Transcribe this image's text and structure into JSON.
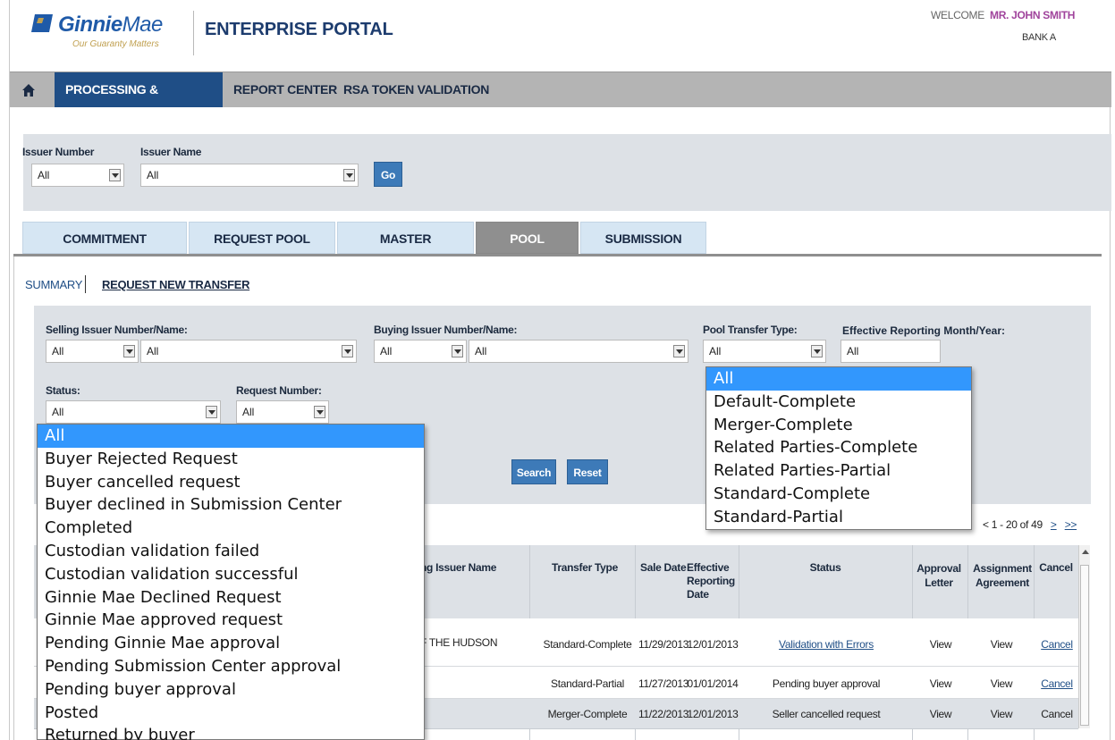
{
  "header": {
    "logo_name_bold": "Ginnie",
    "logo_name_light": "Mae",
    "logo_tagline": "Our Guaranty Matters",
    "portal_title": "ENTERPRISE PORTAL",
    "welcome_label": "WELCOME",
    "user_name": "MR. JOHN SMITH",
    "bank": "BANK A"
  },
  "nav": {
    "home_icon": "home-icon",
    "items": [
      "PROCESSING & SERVICING",
      "REPORT CENTER",
      "RSA TOKEN VALIDATION"
    ],
    "active": "PROCESSING & SERVICING"
  },
  "issuer_filter": {
    "issuer_number_label": "Issuer Number",
    "issuer_number_value": "All",
    "issuer_name_label": "Issuer Name",
    "issuer_name_value": "All",
    "go_label": "Go"
  },
  "tabs": {
    "items": [
      "COMMITMENT MANAGEMENT",
      "REQUEST POOL NUMBERS",
      "MASTER AGREEMENTS",
      "POOL TRANSFER",
      "SUBMISSION CENTER"
    ],
    "active": "POOL TRANSFER"
  },
  "subnav": {
    "summary": "SUMMARY",
    "request_new": "REQUEST NEW TRANSFER"
  },
  "filters": {
    "selling_label": "Selling Issuer Number/Name:",
    "selling_number": "All",
    "selling_name": "All",
    "buying_label": "Buying Issuer Number/Name:",
    "buying_number": "All",
    "buying_name": "All",
    "pool_type_label": "Pool Transfer Type:",
    "pool_type_value": "All",
    "eff_month_label": "Effective Reporting Month/Year:",
    "eff_month_value": "All",
    "status_label": "Status:",
    "status_value": "All",
    "request_number_label": "Request Number:",
    "request_number_value": "All",
    "search_label": "Search",
    "reset_label": "Reset"
  },
  "pool_type_options": [
    "All",
    "Default-Complete",
    "Merger-Complete",
    "Related Parties-Complete",
    "Related Parties-Partial",
    "Standard-Complete",
    "Standard-Partial"
  ],
  "status_options": [
    "All",
    "Buyer Rejected Request",
    "Buyer cancelled request",
    "Buyer declined in Submission Center",
    "Completed",
    "Custodian validation failed",
    "Custodian validation successful",
    "Ginnie Mae Declined Request",
    "Ginnie Mae approved request",
    "Pending Ginnie Mae approval",
    "Pending Submission Center approval",
    "Pending buyer approval",
    "Posted",
    "Returned by buyer"
  ],
  "pager": {
    "prev": "<",
    "range": "1 - 20 of 49",
    "next": ">",
    "last": ">>"
  },
  "table": {
    "headers": {
      "buying_name": "ng Issuer Name",
      "transfer_type": "Transfer Type",
      "sale_date": "Sale Date",
      "eff_date": "Effective Reporting Date",
      "status": "Status",
      "approval": "Approval Letter",
      "assignment": "Assignment Agreement",
      "cancel": "Cancel"
    },
    "rows": [
      {
        "buying_name": "F THE HUDSON",
        "transfer_type": "Standard-Complete",
        "sale_date": "11/29/2013",
        "eff_date": "12/01/2013",
        "status": "Validation with Errors",
        "approval": "View",
        "assignment": "View",
        "cancel": "Cancel"
      },
      {
        "buying_name": "",
        "transfer_type": "Standard-Partial",
        "sale_date": "11/27/2013",
        "eff_date": "01/01/2014",
        "status": "Pending buyer approval",
        "approval": "View",
        "assignment": "View",
        "cancel": "Cancel"
      },
      {
        "buying_name": "",
        "transfer_type": "Merger-Complete",
        "sale_date": "11/22/2013",
        "eff_date": "12/01/2013",
        "status": "Seller cancelled request",
        "approval": "View",
        "assignment": "View",
        "cancel": "Cancel"
      }
    ]
  },
  "colors": {
    "nav_active": "#1f4e86",
    "link": "#1f4e86",
    "button": "#3d7ab8",
    "dropdown_highlight": "#3297fd",
    "welcome_name": "#a0449c"
  }
}
